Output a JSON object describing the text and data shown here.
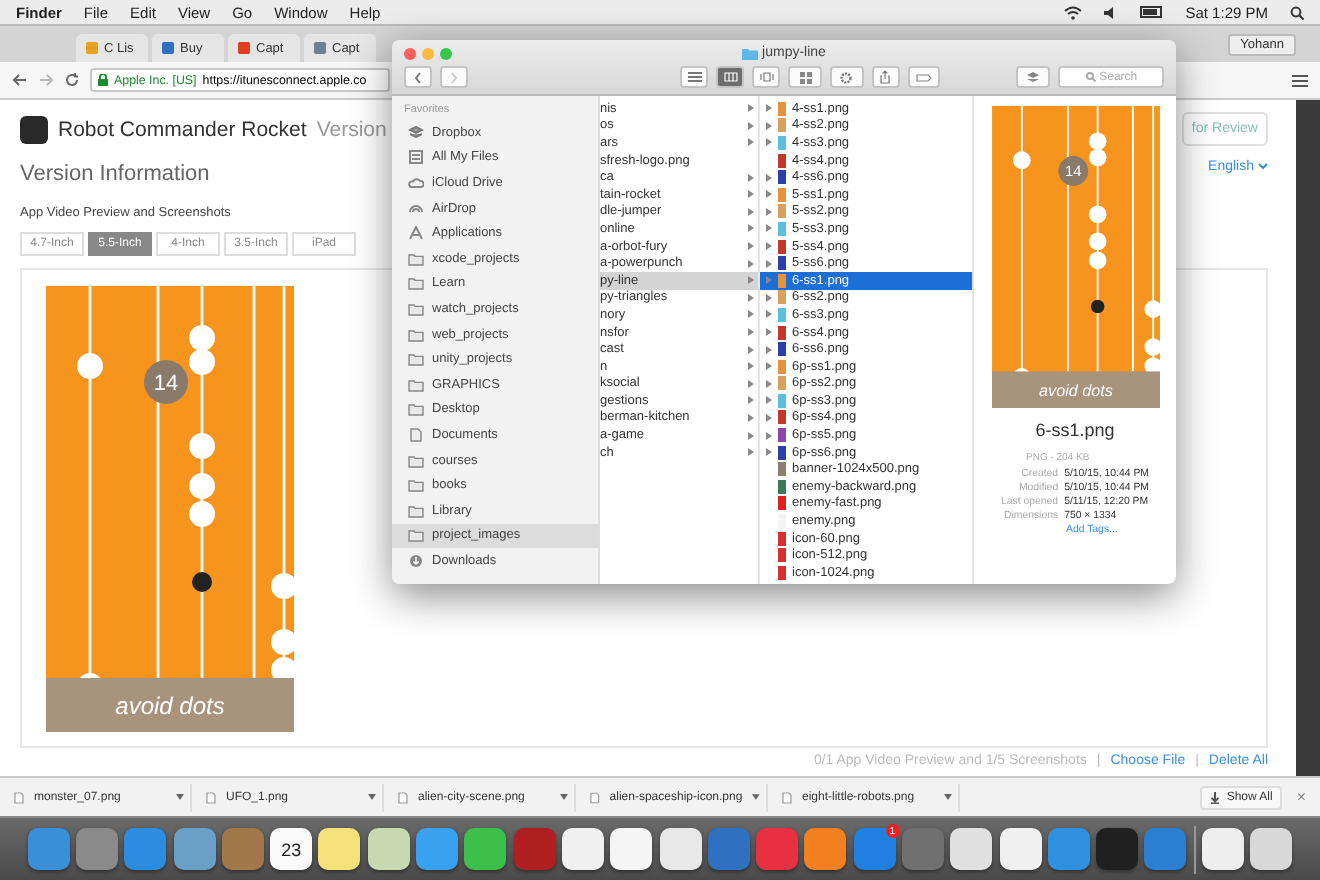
{
  "menu_bar": {
    "app": "Finder",
    "items": [
      "File",
      "Edit",
      "View",
      "Go",
      "Window",
      "Help"
    ],
    "clock": "Sat 1:29 PM"
  },
  "browser": {
    "tabs": [
      {
        "label": "C Lis",
        "color": "#e8a020",
        "selected": false
      },
      {
        "label": "Buy",
        "color": "#3070c0",
        "selected": false
      },
      {
        "label": "Capt",
        "color": "#e04020",
        "selected": false
      },
      {
        "label": "Capt",
        "color": "#708090",
        "selected": false
      }
    ],
    "profile": "Yohann",
    "url": {
      "org": "Apple Inc. [US]",
      "address": "https://itunesconnect.apple.co"
    }
  },
  "page": {
    "app_name": "Robot Commander Rocket",
    "subtitle": "Version",
    "submit": "for Review",
    "section": "Version Information",
    "language": "English",
    "media_heading": "App Video Preview and Screenshots",
    "devices": [
      {
        "label": "4.7-Inch",
        "selected": false
      },
      {
        "label": "5.5-Inch",
        "selected": true
      },
      {
        "label": "4-Inch",
        "selected": false
      },
      {
        "label": "3.5-Inch",
        "selected": false
      },
      {
        "label": "iPad",
        "selected": false
      }
    ],
    "screenshot": {
      "score": "14",
      "banner": "avoid dots"
    },
    "count": "0/1 App Video Preview and 1/5 Screenshots",
    "separator": "|",
    "actions": [
      "Choose File",
      "Delete All"
    ]
  },
  "finder": {
    "title": "jumpy-line",
    "search_placeholder": "Search",
    "sidebar": {
      "heading": "Favorites",
      "items": [
        {
          "label": "Dropbox",
          "kind": "dropbox",
          "selected": false
        },
        {
          "label": "All My Files",
          "kind": "files",
          "selected": false
        },
        {
          "label": "iCloud Drive",
          "kind": "cloud",
          "selected": false
        },
        {
          "label": "AirDrop",
          "kind": "airdrop",
          "selected": false
        },
        {
          "label": "Applications",
          "kind": "apps",
          "selected": false
        },
        {
          "label": "xcode_projects",
          "kind": "folder",
          "selected": false
        },
        {
          "label": "Learn",
          "kind": "folder",
          "selected": false
        },
        {
          "label": "watch_projects",
          "kind": "folder",
          "selected": false
        },
        {
          "label": "web_projects",
          "kind": "folder",
          "selected": false
        },
        {
          "label": "unity_projects",
          "kind": "folder",
          "selected": false
        },
        {
          "label": "GRAPHICS",
          "kind": "folder",
          "selected": false
        },
        {
          "label": "Desktop",
          "kind": "folder",
          "selected": false
        },
        {
          "label": "Documents",
          "kind": "documents",
          "selected": false
        },
        {
          "label": "courses",
          "kind": "folder",
          "selected": false
        },
        {
          "label": "books",
          "kind": "folder",
          "selected": false
        },
        {
          "label": "Library",
          "kind": "folder",
          "selected": false
        },
        {
          "label": "project_images",
          "kind": "folder",
          "selected": true
        },
        {
          "label": "Downloads",
          "kind": "download",
          "selected": false
        }
      ]
    },
    "column_1": [
      {
        "label": "nis",
        "kind": "folder",
        "selected": false
      },
      {
        "label": "os",
        "kind": "folder",
        "selected": false
      },
      {
        "label": "ars",
        "kind": "folder",
        "selected": false
      },
      {
        "label": "sfresh-logo.png",
        "kind": "file",
        "selected": false
      },
      {
        "label": "ca",
        "kind": "folder",
        "selected": false
      },
      {
        "label": "tain-rocket",
        "kind": "folder",
        "selected": false
      },
      {
        "label": "dle-jumper",
        "kind": "folder",
        "selected": false
      },
      {
        "label": "online",
        "kind": "folder",
        "selected": false
      },
      {
        "label": "a-orbot-fury",
        "kind": "folder",
        "selected": false
      },
      {
        "label": "a-powerpunch",
        "kind": "folder",
        "selected": false
      },
      {
        "label": "py-line",
        "kind": "folder",
        "selected": true
      },
      {
        "label": "py-triangles",
        "kind": "folder",
        "selected": false
      },
      {
        "label": "nory",
        "kind": "folder",
        "selected": false
      },
      {
        "label": "nsfor",
        "kind": "folder",
        "selected": false
      },
      {
        "label": "cast",
        "kind": "folder",
        "selected": false
      },
      {
        "label": "n",
        "kind": "folder",
        "selected": false
      },
      {
        "label": "ksocial",
        "kind": "folder",
        "selected": false
      },
      {
        "label": "gestions",
        "kind": "folder",
        "selected": false
      },
      {
        "label": "berman-kitchen",
        "kind": "folder",
        "selected": false
      },
      {
        "label": "a-game",
        "kind": "folder",
        "selected": false
      },
      {
        "label": "ch",
        "kind": "folder",
        "selected": false
      }
    ],
    "column_2": [
      {
        "label": "4-ss1.png",
        "kind": "folder",
        "color": "#e8913f",
        "selected": false
      },
      {
        "label": "4-ss2.png",
        "kind": "folder",
        "color": "#d9a060",
        "selected": false
      },
      {
        "label": "4-ss3.png",
        "kind": "folder",
        "color": "#5bc0de",
        "selected": false
      },
      {
        "label": "4-ss4.png",
        "kind": "file",
        "color": "#c0392b",
        "selected": false
      },
      {
        "label": "4-ss6.png",
        "kind": "folder",
        "color": "#2c3ea8",
        "selected": false
      },
      {
        "label": "5-ss1.png",
        "kind": "folder",
        "color": "#e8913f",
        "selected": false
      },
      {
        "label": "5-ss2.png",
        "kind": "folder",
        "color": "#d9a060",
        "selected": false
      },
      {
        "label": "5-ss3.png",
        "kind": "folder",
        "color": "#5bc0de",
        "selected": false
      },
      {
        "label": "5-ss4.png",
        "kind": "folder",
        "color": "#c0392b",
        "selected": false
      },
      {
        "label": "5-ss6.png",
        "kind": "folder",
        "color": "#2c3ea8",
        "selected": false
      },
      {
        "label": "6-ss1.png",
        "kind": "folder",
        "color": "#e8913f",
        "selected": true
      },
      {
        "label": "6-ss2.png",
        "kind": "folder",
        "color": "#d9a060",
        "selected": false
      },
      {
        "label": "6-ss3.png",
        "kind": "folder",
        "color": "#5bc0de",
        "selected": false
      },
      {
        "label": "6-ss4.png",
        "kind": "folder",
        "color": "#c0392b",
        "selected": false
      },
      {
        "label": "6-ss6.png",
        "kind": "folder",
        "color": "#2c3ea8",
        "selected": false
      },
      {
        "label": "6p-ss1.png",
        "kind": "folder",
        "color": "#e8913f",
        "selected": false
      },
      {
        "label": "6p-ss2.png",
        "kind": "folder",
        "color": "#d9a060",
        "selected": false
      },
      {
        "label": "6p-ss3.png",
        "kind": "folder",
        "color": "#5bc0de",
        "selected": false
      },
      {
        "label": "6p-ss4.png",
        "kind": "folder",
        "color": "#c0392b",
        "selected": false
      },
      {
        "label": "6p-ss5.png",
        "kind": "folder",
        "color": "#8e44ad",
        "selected": false
      },
      {
        "label": "6p-ss6.png",
        "kind": "folder",
        "color": "#2c3ea8",
        "selected": false
      },
      {
        "label": "banner-1024x500.png",
        "kind": "file",
        "color": "#8a8070",
        "selected": false
      },
      {
        "label": "enemy-backward.png",
        "kind": "file",
        "color": "#3b7a5a",
        "selected": false
      },
      {
        "label": "enemy-fast.png",
        "kind": "file",
        "color": "#e02020",
        "selected": false
      },
      {
        "label": "enemy.png",
        "kind": "file",
        "color": "#f4f4f4",
        "selected": false
      },
      {
        "label": "icon-60.png",
        "kind": "file",
        "color": "#d83030",
        "selected": false
      },
      {
        "label": "icon-512.png",
        "kind": "file",
        "color": "#d83030",
        "selected": false
      },
      {
        "label": "icon-1024.png",
        "kind": "file",
        "color": "#d83030",
        "selected": false
      }
    ],
    "preview": {
      "score": "14",
      "banner": "avoid dots",
      "name": "6-ss1.png",
      "info": "PNG - 204 KB",
      "fields": [
        {
          "label": "Created",
          "value": "5/10/15, 10:44 PM"
        },
        {
          "label": "Modified",
          "value": "5/10/15, 10:44 PM"
        },
        {
          "label": "Last opened",
          "value": "5/11/15, 12:20 PM"
        },
        {
          "label": "Dimensions",
          "value": "750 × 1334"
        }
      ],
      "add_tags": "Add Tags..."
    }
  },
  "downloads": {
    "files": [
      "monster_07.png",
      "UFO_1.png",
      "alien-city-scene.png",
      "alien-spaceship-icon.png",
      "eight-little-robots.png"
    ],
    "show_all": "Show All",
    "close": "×"
  },
  "dock": [
    {
      "color": "#3b8fd9"
    },
    {
      "color": "#8a8a8a"
    },
    {
      "color": "#2a8de0"
    },
    {
      "color": "#6a9fc8"
    },
    {
      "color": "#a0784a"
    },
    {
      "color": "#fafafa",
      "label": "23"
    },
    {
      "color": "#f5e27a"
    },
    {
      "color": "#c8d8b0"
    },
    {
      "color": "#3aa0f0"
    },
    {
      "color": "#3cc04a"
    },
    {
      "color": "#b02020"
    },
    {
      "color": "#f0f0f0"
    },
    {
      "color": "#f5f5f5"
    },
    {
      "color": "#e8e8e8"
    },
    {
      "color": "#3070c0"
    },
    {
      "color": "#e83040"
    },
    {
      "color": "#f08020"
    },
    {
      "color": "#2080e0",
      "badge": "1"
    },
    {
      "color": "#707070"
    },
    {
      "color": "#e0e0e0"
    },
    {
      "color": "#f0f0f0"
    },
    {
      "color": "#3090e0"
    },
    {
      "color": "#202020"
    },
    {
      "color": "#2a7fd0"
    },
    {
      "color": "#eeeeee"
    },
    {
      "color": "#d8d8d8"
    }
  ]
}
